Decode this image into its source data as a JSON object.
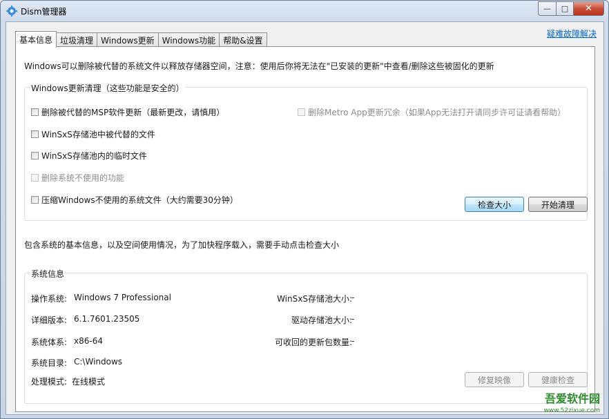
{
  "window": {
    "title": "Dism管理器"
  },
  "tabs": [
    {
      "label": "基本信息",
      "active": true
    },
    {
      "label": "垃圾清理",
      "active": false
    },
    {
      "label": "Windows更新",
      "active": false
    },
    {
      "label": "Windows功能",
      "active": false
    },
    {
      "label": "帮助&设置",
      "active": false
    }
  ],
  "fault_link": "疑难故障解决",
  "notice": "Windows可以删除被代替的系统文件以释放存储器空间，注意：使用后你将无法在\"已安装的更新\"中查看/删除这些被固化的更新",
  "cleanup_group": {
    "title": "Windows更新清理（这些功能是安全的）",
    "options": [
      {
        "label": "删除被代替的MSP软件更新（最新更改，请慎用）",
        "checked": false,
        "enabled": true
      },
      {
        "label": "WinSxS存储池中被代替的文件",
        "checked": false,
        "enabled": true
      },
      {
        "label": "WinSxS存储池内的临时文件",
        "checked": false,
        "enabled": true
      },
      {
        "label": "删除系统不使用的功能",
        "checked": false,
        "enabled": false
      },
      {
        "label": "压缩Windows不使用的系统文件（大约需要30分钟）",
        "checked": false,
        "enabled": true
      }
    ],
    "metro_option": {
      "label": "删除Metro App更新冗余（如果App无法打开请同步许可证请看帮助）",
      "checked": false,
      "enabled": false
    },
    "check_size_button": "检查大小",
    "start_clean_button": "开始清理"
  },
  "info_note": "包含系统的基本信息，以及空间使用情况，为了加快程序载入，需要手动点击检查大小",
  "sysinfo": {
    "title": "系统信息",
    "os_label": "操作系统:",
    "os_value": "Windows 7 Professional",
    "version_label": "详细版本:",
    "version_value": "6.1.7601.23505",
    "arch_label": "系统体系:",
    "arch_value": "x86-64",
    "dir_label": "系统目录:",
    "dir_value": "C:\\Windows",
    "mode_label": "处理模式:",
    "mode_value": "在线模式",
    "winsxs_label": "WinSxS存储池大小:",
    "winsxs_value": "-",
    "driver_label": "驱动存储池大小:",
    "driver_value": "-",
    "reclaim_label": "可收回的更新包数量:",
    "reclaim_value": "-",
    "repair_button": "修复映像",
    "health_button": "健康检查"
  },
  "watermark": {
    "name": "吾爱软件园",
    "url": "www.52zixue.com"
  }
}
